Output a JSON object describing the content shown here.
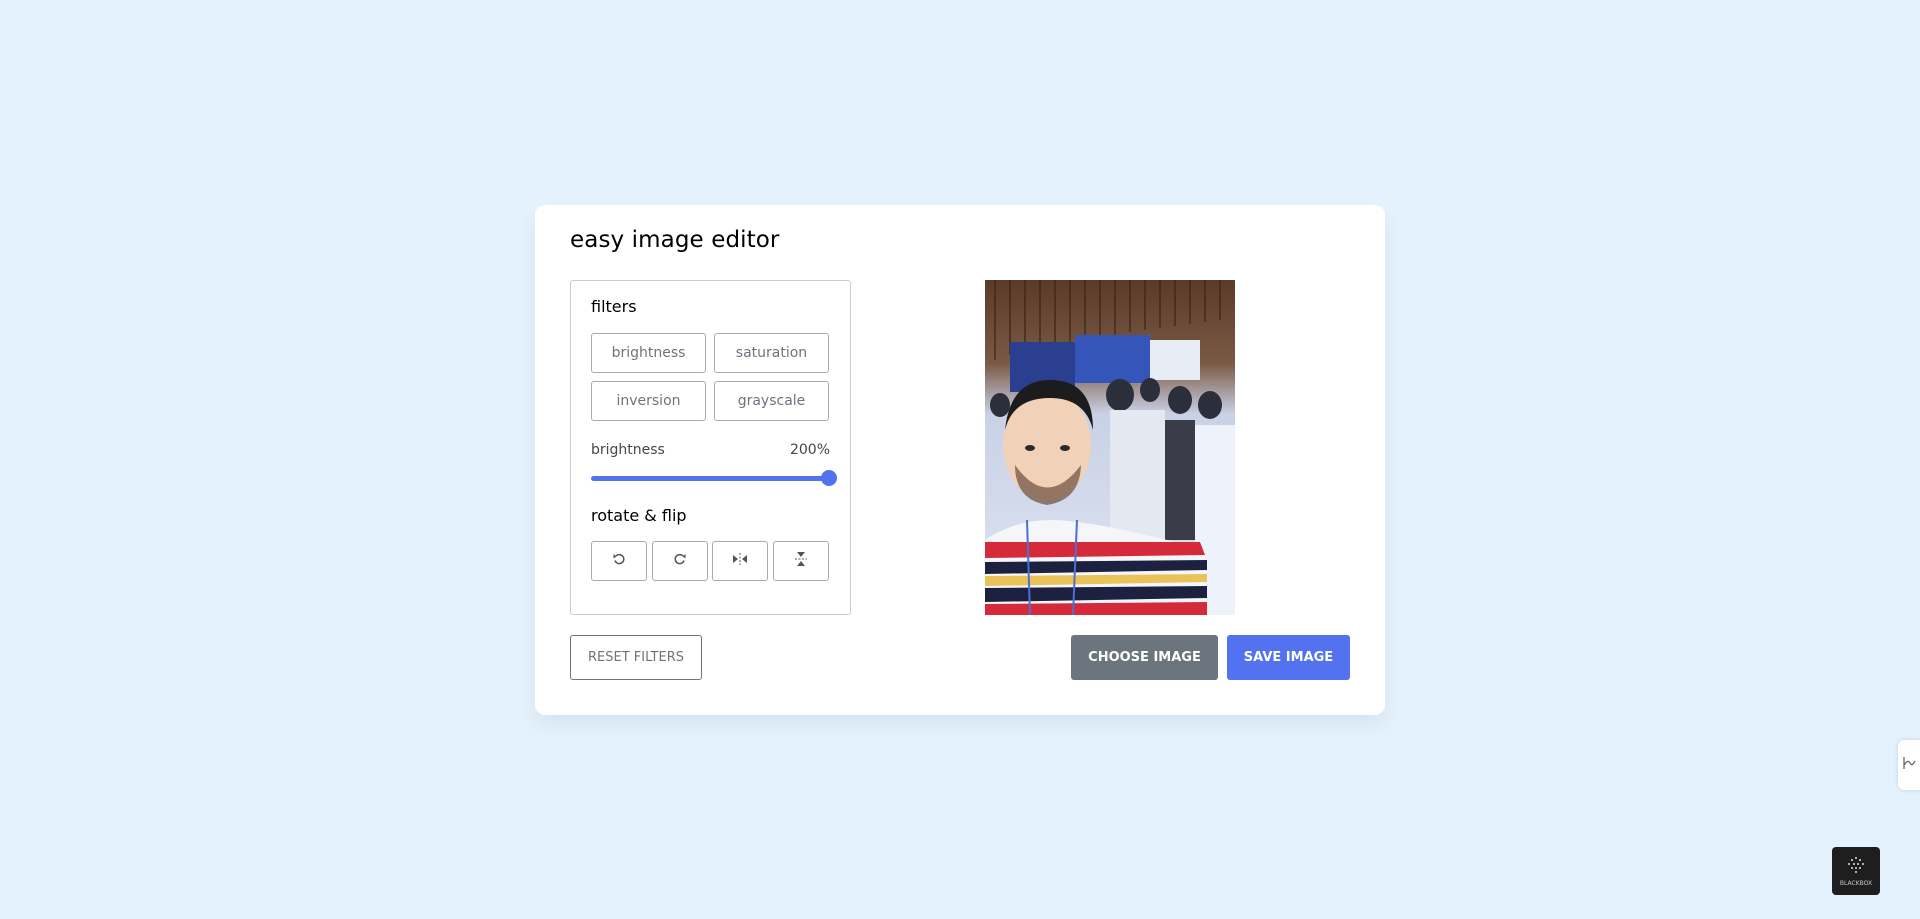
{
  "app": {
    "title": "easy image editor"
  },
  "filters": {
    "heading": "filters",
    "options": [
      {
        "label": "brightness"
      },
      {
        "label": "saturation"
      },
      {
        "label": "inversion"
      },
      {
        "label": "grayscale"
      }
    ],
    "active": "brightness",
    "slider": {
      "name": "brightness",
      "value_text": "200%",
      "value": 200,
      "max": 200,
      "fill_fraction": 1.0
    }
  },
  "rotate_flip": {
    "heading": "rotate & flip",
    "buttons": [
      {
        "icon": "rotate-left-icon"
      },
      {
        "icon": "rotate-right-icon"
      },
      {
        "icon": "flip-horizontal-icon"
      },
      {
        "icon": "flip-vertical-icon"
      }
    ]
  },
  "actions": {
    "reset_label": "Reset Filters",
    "choose_label": "CHOOSE IMAGE",
    "save_label": "SAVE IMAGE"
  },
  "widgets": {
    "blackbox_label": "BLACKBOX"
  },
  "colors": {
    "background": "#e3f2fd",
    "accent": "#5372f0",
    "secondary": "#6c757d"
  }
}
